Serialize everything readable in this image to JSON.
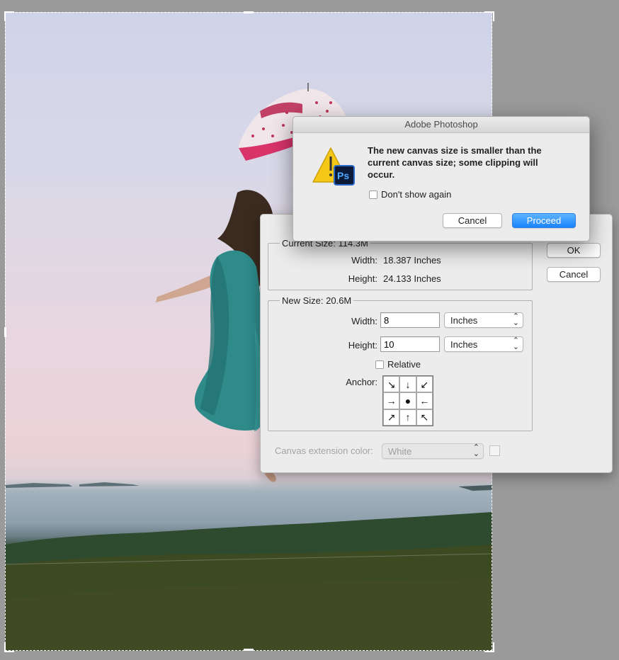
{
  "photo": {
    "description_icon": "photo-canvas"
  },
  "canvas_size_dialog": {
    "current_size": {
      "title": "Current Size: 114.3M",
      "width_label": "Width:",
      "width_value": "18.387 Inches",
      "height_label": "Height:",
      "height_value": "24.133 Inches"
    },
    "new_size": {
      "title": "New Size: 20.6M",
      "width_label": "Width:",
      "width_value": "8",
      "width_unit": "Inches",
      "height_label": "Height:",
      "height_value": "10",
      "height_unit": "Inches",
      "relative_label": "Relative",
      "relative_checked": false,
      "anchor_label": "Anchor:"
    },
    "extension": {
      "label": "Canvas extension color:",
      "value": "White"
    },
    "ok_label": "OK",
    "cancel_label": "Cancel"
  },
  "alert": {
    "title": "Adobe Photoshop",
    "message": "The new canvas size is smaller than the current canvas size; some clipping will occur.",
    "dont_show_label": "Don't show again",
    "dont_show_checked": false,
    "cancel_label": "Cancel",
    "proceed_label": "Proceed",
    "icon": "warning-photoshop-icon"
  },
  "colors": {
    "primary_button": "#1a82fb",
    "dialog_bg": "#ececec",
    "workspace_bg": "#9a9a9a"
  }
}
